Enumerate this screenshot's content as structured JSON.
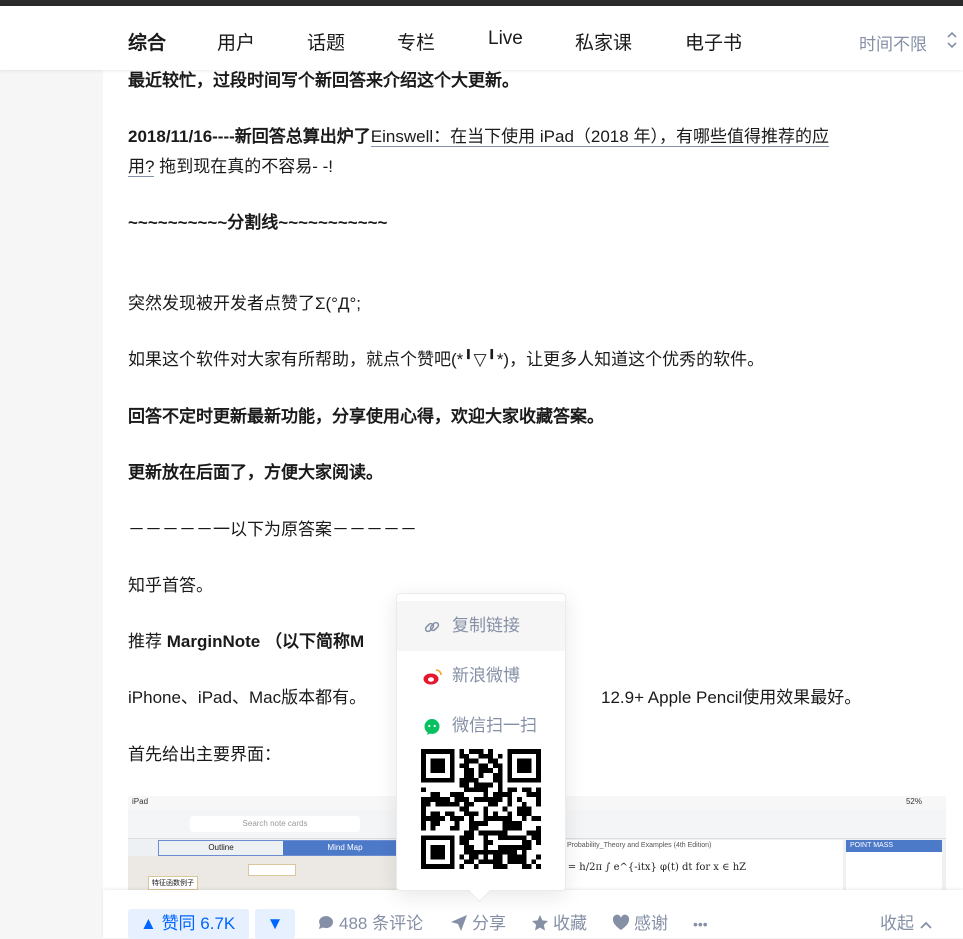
{
  "tabs": [
    {
      "label": "综合",
      "active": true
    },
    {
      "label": "用户"
    },
    {
      "label": "话题"
    },
    {
      "label": "专栏"
    },
    {
      "label": "Live"
    },
    {
      "label": "私家课"
    },
    {
      "label": "电子书"
    }
  ],
  "time_filter": "时间不限",
  "content": {
    "line1": "最近较忙，过段时间写个新回答来介绍这个大更新。",
    "line2_bold": "2018/11/16----新回答总算出炉了",
    "line2_link": "Einswell：在当下使用 iPad（2018 年），有哪些值得推荐的应",
    "line3_link": "用?",
    "line3_rest": " 拖到现在真的不容易- -!",
    "divider": "~~~~~~~~~~分割线~~~~~~~~~~~",
    "line4": "突然发现被开发者点赞了Σ(°Д°;",
    "line5": "如果这个软件对大家有所帮助，就点个赞吧(*╹▽╹*)，让更多人知道这个优秀的软件。",
    "line6": "回答不定时更新最新功能，分享使用心得，欢迎大家收藏答案。",
    "line7": "更新放在后面了，方便大家阅读。",
    "line8": "－－－－－一以下为原答案－－－－－",
    "line9": "知乎首答。",
    "line10_pre": "推荐 ",
    "line10_bold": "MarginNote （以下简称M",
    "line11_a": "iPhone、iPad、Mac版本都有。",
    "line11_b": "12.9+ Apple Pencil使用效果最好。",
    "line12": "首先给出主要界面："
  },
  "figure": {
    "status_left": "iPad",
    "status_right": "52%",
    "search_placeholder": "Search note cards",
    "seg_outline": "Outline",
    "seg_mindmap": "Mind Map",
    "node_text": "特征函数例子",
    "doc_title": "Probability_Theory and Examples (4th Edition)",
    "formula": "x) = h/2π ∫ e^{-itx} φ(t) dt    for x ∈ hZ",
    "point_mass": "POINT MASS"
  },
  "actions": {
    "upvote": "赞同 6.7K",
    "comments": "488 条评论",
    "share": "分享",
    "favorite": "收藏",
    "thanks": "感谢",
    "more": "•••",
    "collapse": "收起"
  },
  "share_popover": {
    "copy_link": "复制链接",
    "weibo": "新浪微博",
    "wechat": "微信扫一扫"
  },
  "colors": {
    "accent": "#0066ff",
    "muted": "#8590a6",
    "weibo": "#e6162d",
    "wechat": "#07c160"
  }
}
